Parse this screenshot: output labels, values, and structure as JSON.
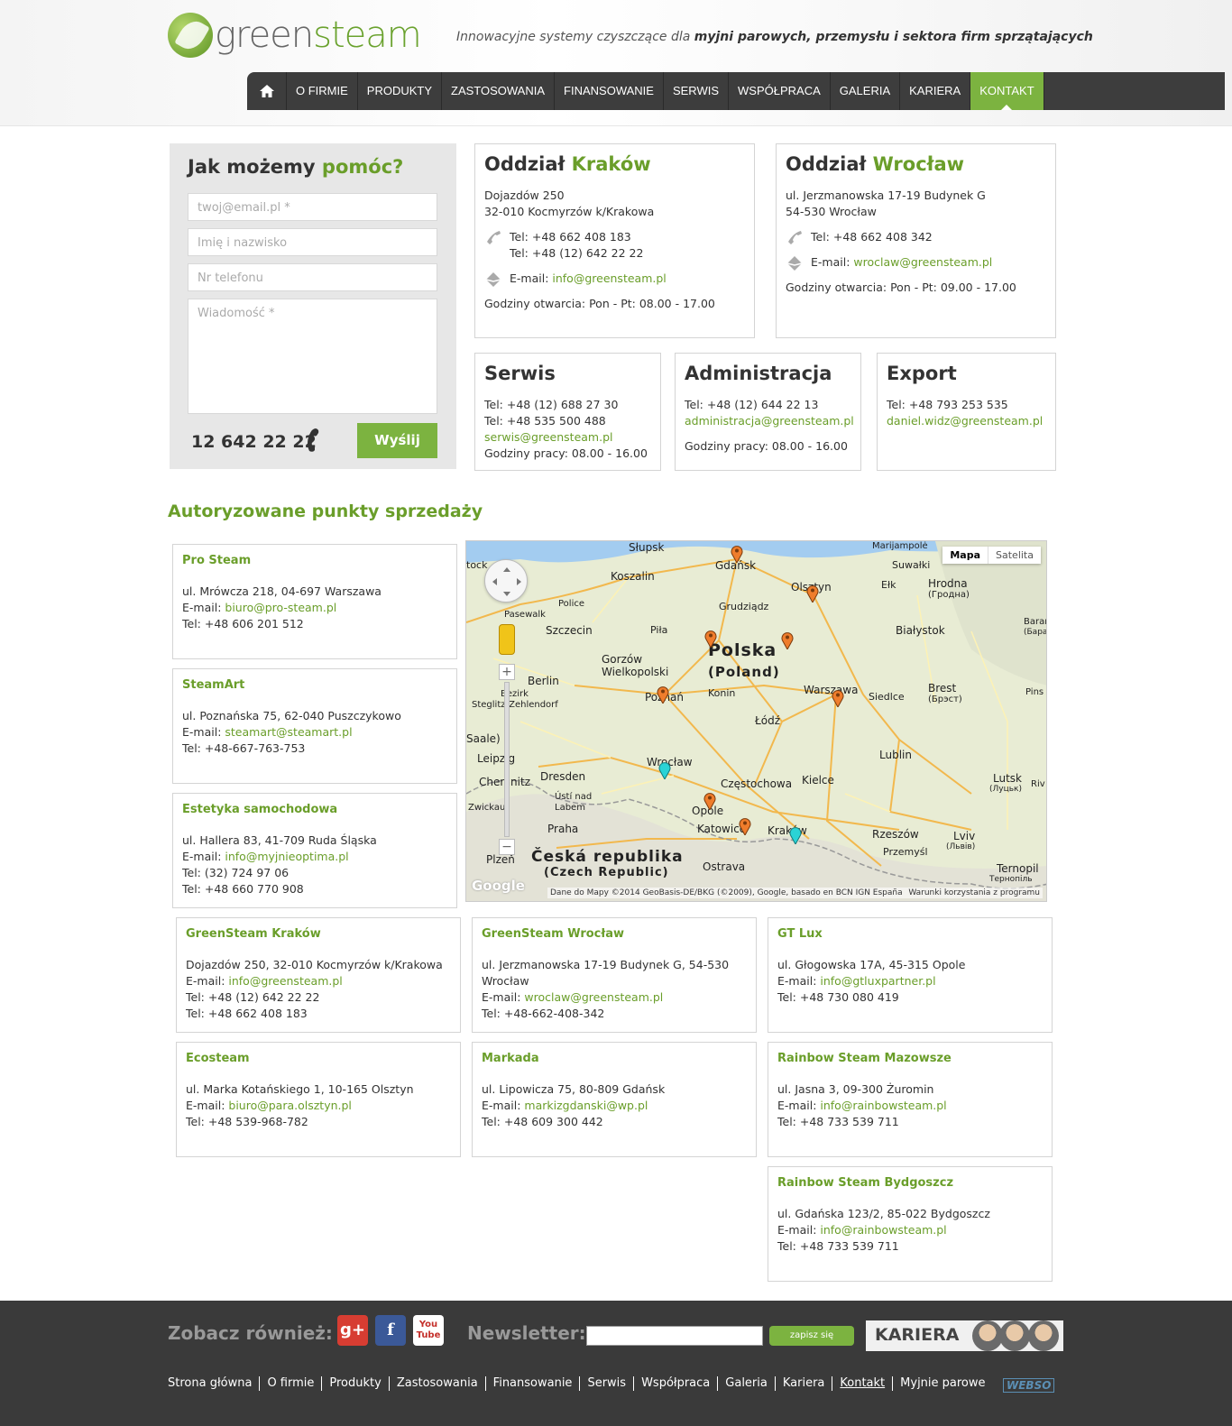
{
  "header": {
    "logo_a": "green",
    "logo_b": "steam",
    "tagline_a": "Innowacyjne systemy czyszczące dla ",
    "tagline_b": "myjni parowych, przemysłu i sektora firm sprzątających"
  },
  "nav": [
    "O FIRMIE",
    "PRODUKTY",
    "ZASTOSOWANIA",
    "FINANSOWANIE",
    "SERWIS",
    "WSPÓŁPRACA",
    "GALERIA",
    "KARIERA",
    "KONTAKT"
  ],
  "form": {
    "title_a": "Jak możemy ",
    "title_b": "pomóc?",
    "email_placeholder": "twoj@email.pl *",
    "name_placeholder": "Imię i nazwisko",
    "phone_placeholder": "Nr telefonu",
    "message_placeholder": "Wiadomość *",
    "phone": "12 642 22 22",
    "send": "Wyślij"
  },
  "krakow": {
    "title_a": "Oddział ",
    "title_b": "Kraków",
    "addr1": "Dojazdów 250",
    "addr2": "32-010 Kocmyrzów k/Krakowa",
    "tel1": "Tel: +48 662 408 183",
    "tel2": "Tel: +48 (12) 642 22 22",
    "email_label": "E-mail: ",
    "email": "info@greensteam.pl",
    "hours": "Godziny otwarcia: Pon - Pt: 08.00 - 17.00"
  },
  "wroclaw": {
    "title_a": "Oddział ",
    "title_b": "Wrocław",
    "addr1": "ul. Jerzmanowska 17-19 Budynek G",
    "addr2": "54-530 Wrocław",
    "tel1": "Tel: +48 662 408 342",
    "email_label": "E-mail: ",
    "email": "wroclaw@greensteam.pl",
    "hours": "Godziny otwarcia: Pon - Pt: 09.00 - 17.00"
  },
  "serwis": {
    "title": "Serwis",
    "tel1": "Tel: +48 (12) 688 27 30",
    "tel2": "Tel: +48 535 500 488",
    "email": "serwis@greensteam.pl",
    "hours": "Godziny pracy: 08.00 - 16.00"
  },
  "administracja": {
    "title": "Administracja",
    "tel1": "Tel: +48 (12) 644 22 13",
    "email": "administracja@greensteam.pl",
    "hours": "Godziny pracy: 08.00 - 16.00"
  },
  "export": {
    "title": "Export",
    "tel1": "Tel: +48 793 253 535",
    "email": "daniel.widz@greensteam.pl"
  },
  "section_title": "Autoryzowane punkty sprzedaży",
  "dealers": [
    {
      "name": "Pro Steam",
      "addr": "ul. Mrówcza 218, 04-697 Warszawa",
      "email": "biuro@pro-steam.pl",
      "tel": "Tel: +48 606 201 512"
    },
    {
      "name": "SteamArt",
      "addr": "ul. Poznańska 75, 62-040 Puszczykowo",
      "email": "steamart@steamart.pl",
      "tel": "Tel: +48-667-763-753"
    },
    {
      "name": "Estetyka samochodowa",
      "addr": "ul. Hallera 83, 41-709 Ruda Śląska",
      "email": "info@myjnieoptima.pl",
      "tel": "Tel: (32) 724 97 06",
      "tel2": "Tel: +48 660 770 908"
    },
    {
      "name": "GreenSteam Kraków",
      "addr": "Dojazdów 250, 32-010 Kocmyrzów k/Krakowa",
      "email": "info@greensteam.pl",
      "tel": "Tel: +48 (12) 642 22 22",
      "tel2": "Tel: +48 662 408 183"
    },
    {
      "name": "GreenSteam Wrocław",
      "addr": "ul. Jerzmanowska 17-19 Budynek G, 54-530 Wrocław",
      "email": "wroclaw@greensteam.pl",
      "tel": "Tel: +48-662-408-342"
    },
    {
      "name": "GT Lux",
      "addr": "ul. Głogowska 17A, 45-315 Opole",
      "email": "info@gtluxpartner.pl",
      "tel": "Tel: +48 730 080 419"
    },
    {
      "name": "Ecosteam",
      "addr": "ul. Marka Kotańskiego 1, 10-165 Olsztyn",
      "email": "biuro@para.olsztyn.pl",
      "tel": "Tel: +48 539-968-782"
    },
    {
      "name": "Markada",
      "addr": "ul. Lipowicza 75, 80-809 Gdańsk",
      "email": "markizgdanski@wp.pl",
      "tel": "Tel: +48 609 300 442"
    },
    {
      "name": "Rainbow Steam Mazowsze",
      "addr": "ul. Jasna 3, 09-300 Żuromin",
      "email": "info@rainbowsteam.pl",
      "tel": "Tel: +48 733 539 711"
    },
    {
      "name": "Rainbow Steam Bydgoszcz",
      "addr": "ul. Gdańska 123/2, 85-022 Bydgoszcz",
      "email": "info@rainbowsteam.pl",
      "tel": "Tel: +48 733 539 711"
    }
  ],
  "email_label": "E-mail: ",
  "map": {
    "type_map": "Mapa",
    "type_sat": "Satelita",
    "country": "Polska",
    "country_sub": "(Poland)",
    "czech": "Česká republika",
    "czech_sub": "(Czech Republic)",
    "cities": {
      "slupsk": "Słupsk",
      "gdansk": "Gdańsk",
      "koszalin": "Koszalin",
      "olsztyn": "Olsztyn",
      "suwalki": "Suwałki",
      "hrodna": "Hrodna",
      "hrodna_ru": "(Гродна)",
      "elk": "Ełk",
      "grudziadz": "Grudziądz",
      "police": "Police",
      "pasewalk": "Pasewalk",
      "szczecin": "Szczecin",
      "pila": "Piła",
      "bialystok": "Białystok",
      "gorzow": "Gorzów",
      "wielkopolski": "Wielkopolski",
      "berlin": "Berlin",
      "bezirk": "Bezirk",
      "steglitz": "Steglitz-Zehlendorf",
      "poznan": "Poznań",
      "konin": "Konin",
      "warszawa": "Warszawa",
      "siedlce": "Siedlce",
      "brest": "Brest",
      "brest_ru": "(Брэст)",
      "lodz": "Łódź",
      "saale": "Saale)",
      "leipzig": "Leipzig",
      "lublin": "Lublin",
      "wroclaw": "Wrocław",
      "chemnitz": "Chemnitz",
      "dresden": "Dresden",
      "czestochowa": "Częstochowa",
      "kielce": "Kielce",
      "lutsk": "Lutsk",
      "lutsk_ru": "(Луцьк)",
      "usti": "Ústí nad",
      "labem": "Labem",
      "opole": "Opole",
      "zwickau": "Zwickau",
      "katowice": "Katowice",
      "krakow": "Kraków",
      "rzeszow": "Rzeszów",
      "praha": "Praha",
      "przemysl": "Przemyśl",
      "lviv": "Lviv",
      "lviv_ru": "(Львів)",
      "plzen": "Plzeň",
      "ostrava": "Ostrava",
      "ternopil": "Ternopil",
      "ternopil_ru": "Тернопіль",
      "baranav": "Baranav",
      "baranav_ru": "(Баранав",
      "pins": "Pins",
      "riv": "Riv",
      "marijampole": "Marijampolė",
      "stock": "tock"
    },
    "attribution": "Dane do Mapy ©2014 GeoBasis-DE/BKG (©2009), Google, basado en BCN IGN España",
    "terms": "Warunki korzystania z programu",
    "google": "Google"
  },
  "footer": {
    "see_also": "Zobacz również:",
    "youtube_a": "You",
    "youtube_b": "Tube",
    "gplus": "g+",
    "facebook": "f",
    "newsletter": "Newsletter:",
    "subscribe": "zapisz się",
    "kariera": "KARIERA",
    "links": [
      "Strona główna",
      "O firmie",
      "Produkty",
      "Zastosowania",
      "Finansowanie",
      "Serwis",
      "Współpraca",
      "Galeria",
      "Kariera",
      "Kontakt",
      "Myjnie parowe"
    ],
    "webso": "WEBSO"
  },
  "colors": {
    "accent": "#7cb340",
    "nav": "#3d3d3d",
    "footer": "#3a3a3a"
  }
}
